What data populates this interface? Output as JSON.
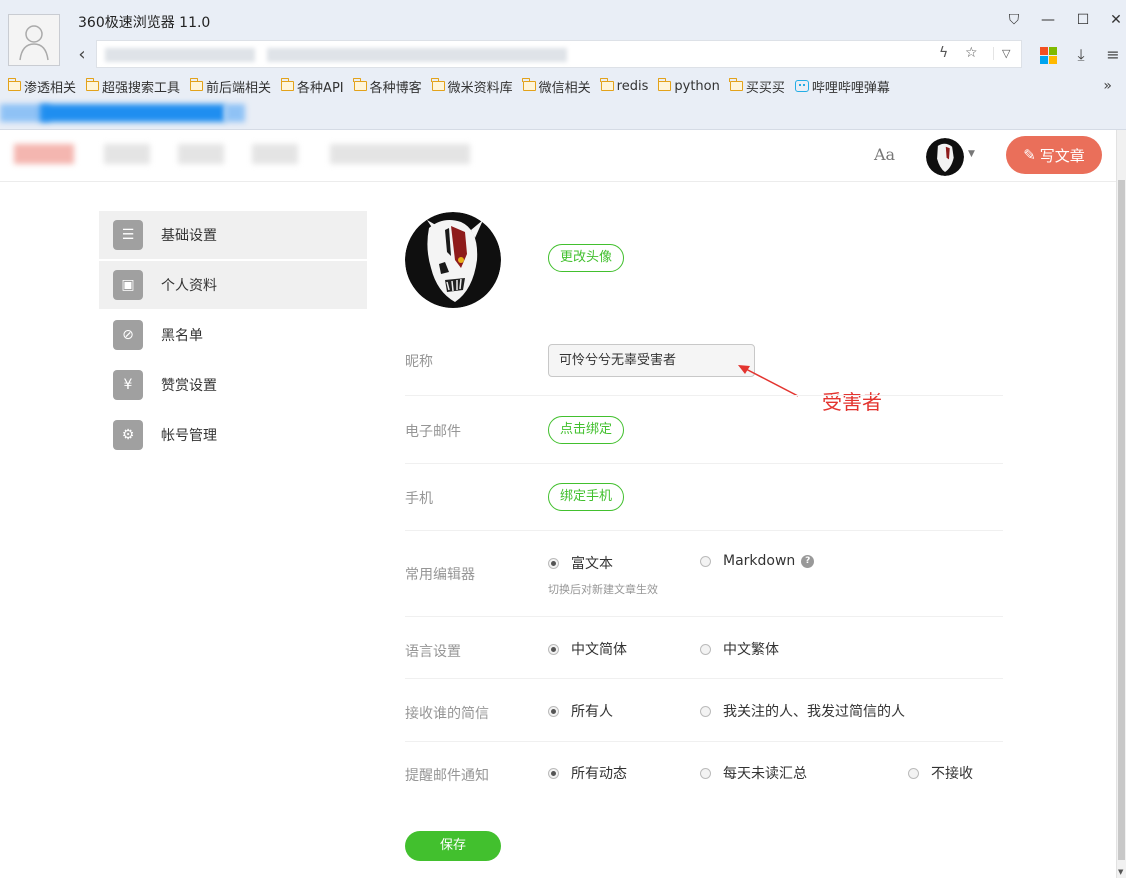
{
  "browser": {
    "title": "360极速浏览器 11.0",
    "bookmarks": [
      {
        "label": "渗透相关",
        "icon": "folder-icon"
      },
      {
        "label": "超强搜索工具",
        "icon": "folder-icon"
      },
      {
        "label": "前后端相关",
        "icon": "folder-icon"
      },
      {
        "label": "各种API",
        "icon": "folder-icon"
      },
      {
        "label": "各种博客",
        "icon": "folder-icon"
      },
      {
        "label": "微米资料库",
        "icon": "folder-icon"
      },
      {
        "label": "微信相关",
        "icon": "folder-icon"
      },
      {
        "label": "redis",
        "icon": "folder-icon"
      },
      {
        "label": "python",
        "icon": "folder-icon"
      },
      {
        "label": "买买买",
        "icon": "folder-icon"
      },
      {
        "label": "哔哩哔哩弹幕",
        "icon": "bilibili-icon"
      }
    ],
    "more": "»",
    "window_controls": {
      "skin": "⛉",
      "minimize": "—",
      "maximize": "☐",
      "close": "✕"
    }
  },
  "header": {
    "font_toggle": "Aa",
    "write_button": "写文章"
  },
  "sidebar": {
    "items": [
      {
        "label": "基础设置",
        "icon": "list-icon",
        "glyph": "☰"
      },
      {
        "label": "个人资料",
        "icon": "profile-card-icon",
        "glyph": "▣"
      },
      {
        "label": "黑名单",
        "icon": "ban-icon",
        "glyph": "⊘"
      },
      {
        "label": "赞赏设置",
        "icon": "yen-icon",
        "glyph": "¥"
      },
      {
        "label": "帐号管理",
        "icon": "gear-icon",
        "glyph": "⚙"
      }
    ]
  },
  "form": {
    "change_avatar": "更改头像",
    "nickname": {
      "label": "昵称",
      "value": "可怜兮兮无辜受害者"
    },
    "email": {
      "label": "电子邮件",
      "button": "点击绑定"
    },
    "phone": {
      "label": "手机",
      "button": "绑定手机"
    },
    "editor": {
      "label": "常用编辑器",
      "options": [
        "富文本",
        "Markdown"
      ],
      "selected": "富文本",
      "hint": "切换后对新建文章生效",
      "help": "?"
    },
    "language": {
      "label": "语言设置",
      "options": [
        "中文简体",
        "中文繁体"
      ],
      "selected": "中文简体"
    },
    "messages": {
      "label": "接收谁的简信",
      "options": [
        "所有人",
        "我关注的人、我发过简信的人"
      ],
      "selected": "所有人"
    },
    "email_notify": {
      "label": "提醒邮件通知",
      "options": [
        "所有动态",
        "每天未读汇总",
        "不接收"
      ],
      "selected": "所有动态"
    },
    "save": "保存"
  },
  "annotation": {
    "text": "受害者",
    "color": "#e3342f"
  },
  "colors": {
    "accent_green": "#42c02e",
    "write_button": "#ea6f5a"
  }
}
